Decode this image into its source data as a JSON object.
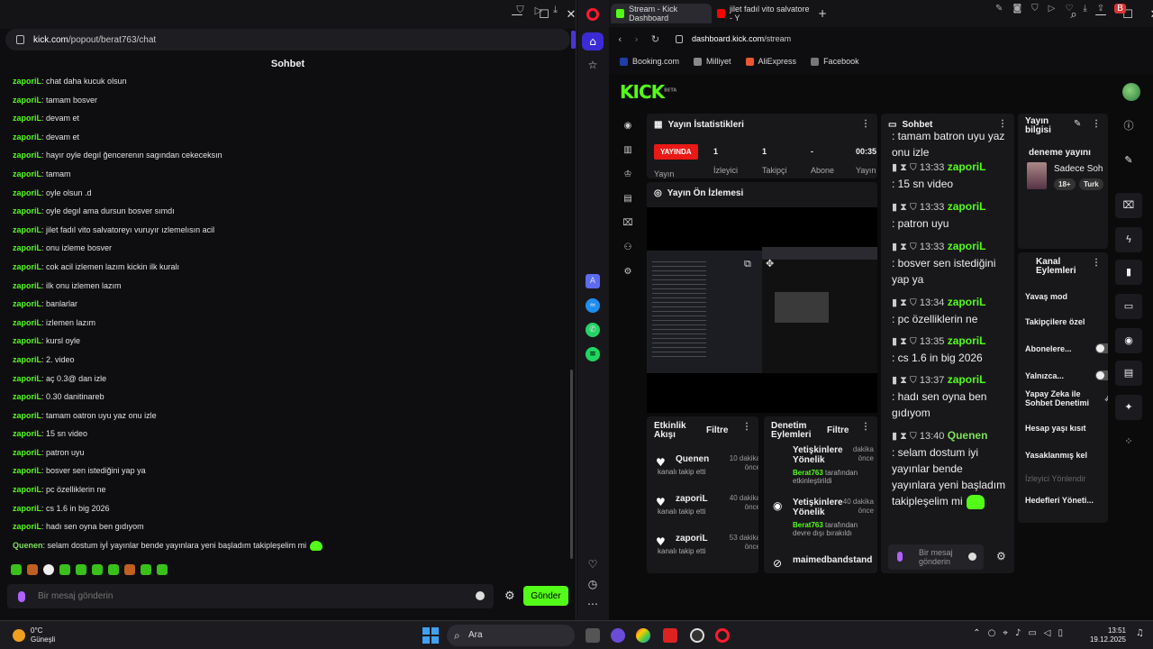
{
  "left_window": {
    "url_domain": "kick.com",
    "url_path": "/popout/berat763/chat",
    "chat_title": "Sohbet",
    "messages": [
      {
        "user": "zaporiL",
        "text": ": chat daha kucuk olsun"
      },
      {
        "user": "zaporiL",
        "text": ": tamam bosver"
      },
      {
        "user": "zaporiL",
        "text": ": devam et"
      },
      {
        "user": "zaporiL",
        "text": ": devam et"
      },
      {
        "user": "zaporiL",
        "text": ": hayır oyle degıl ğencerenın sagından cekeceksın"
      },
      {
        "user": "zaporiL",
        "text": ": tamam"
      },
      {
        "user": "zaporiL",
        "text": ": oyle olsun .d"
      },
      {
        "user": "zaporiL",
        "text": ": oyle degıl ama dursun bosver sımdı"
      },
      {
        "user": "zaporiL",
        "text": ": jilet fadıl vito salvatoreyı vuruyır ızlemelısın acil"
      },
      {
        "user": "zaporiL",
        "text": ": onu izleme bosver"
      },
      {
        "user": "zaporiL",
        "text": ": cok acil izlemen lazım kickin ilk kuralı"
      },
      {
        "user": "zaporiL",
        "text": ": ilk onu izlemen lazım"
      },
      {
        "user": "zaporiL",
        "text": ": banlarlar"
      },
      {
        "user": "zaporiL",
        "text": ": izlemen lazım"
      },
      {
        "user": "zaporiL",
        "text": ": kursl oyle"
      },
      {
        "user": "zaporiL",
        "text": ": 2. video"
      },
      {
        "user": "zaporiL",
        "text": ": aç 0.3@ dan izle"
      },
      {
        "user": "zaporiL",
        "text": ": 0.30 danitinareb"
      },
      {
        "user": "zaporiL",
        "text": ": tamam oatron uyu yaz onu izle"
      },
      {
        "user": "zaporiL",
        "text": ": 15 sn video"
      },
      {
        "user": "zaporiL",
        "text": ": patron uyu"
      },
      {
        "user": "zaporiL",
        "text": ": bosver sen istediğini yap ya"
      },
      {
        "user": "zaporiL",
        "text": ": pc özelliklerin ne"
      },
      {
        "user": "zaporiL",
        "text": ": cs 1.6 in big 2026"
      },
      {
        "user": "zaporiL",
        "text": ": hadı sen oyna ben gıdıyom"
      },
      {
        "user": "Quenen",
        "text": ": selam dostum iyİ yayınlar bende yayınlara yeni başladım takipleşelim mi"
      }
    ],
    "input_placeholder": "Bir mesaj gönderin",
    "send_label": "Gönder"
  },
  "right_window": {
    "tabs": [
      {
        "label": "Stream - Kick Dashboard"
      },
      {
        "label": "jilet fadıl vito salvatore - Y"
      }
    ],
    "url_domain": "dashboard.kick.com",
    "url_path": "/stream",
    "bookmarks": [
      "Booking.com",
      "Milliyet",
      "AliExpress",
      "Facebook"
    ],
    "logo": "KICK",
    "logo_beta": "BETA",
    "stats": {
      "title": "Yayın İstatistikleri",
      "live": "YAYINDA",
      "viewers": "1",
      "followers": "1",
      "subs": "-",
      "time": "00:35",
      "l_stream": "Yayın",
      "l_viewers": "İzleyici",
      "l_followers": "Takipçi",
      "l_subs": "Abone",
      "l_time": "Yayın"
    },
    "preview_title": "Yayın Ön İzlemesi",
    "chat": {
      "title": "Sohbet",
      "top_text": ": tamam batron uyu yaz onu izle",
      "messages": [
        {
          "time": "13:33",
          "user": "zaporiL",
          "text": ": 15 sn video"
        },
        {
          "time": "13:33",
          "user": "zaporiL",
          "text": ": patron uyu"
        },
        {
          "time": "13:33",
          "user": "zaporiL",
          "text": ": bosver sen istediğini yap ya"
        },
        {
          "time": "13:34",
          "user": "zaporiL",
          "text": ": pc özelliklerin ne"
        },
        {
          "time": "13:35",
          "user": "zaporiL",
          "text": ": cs 1.6 in big 2026"
        },
        {
          "time": "13:37",
          "user": "zaporiL",
          "text": ": hadı sen oyna ben gıdıyom"
        },
        {
          "time": "13:40",
          "user": "Quenen",
          "text": ": selam dostum iyi yayınlar bende yayınlara yeni başladım takipleşelim mi"
        }
      ],
      "input_placeholder": "Bir mesaj gönderin"
    },
    "activity": {
      "title": "Etkinlik Akışı",
      "filter": "Filtre",
      "items": [
        {
          "name": "Quenen",
          "sub": "kanalı takip etti",
          "time": "10 dakika önce"
        },
        {
          "name": "zaporiL",
          "sub": "kanalı takip etti",
          "time": "40 dakika önce"
        },
        {
          "name": "zaporiL",
          "sub": "kanalı takip etti",
          "time": "53 dakika önce"
        }
      ]
    },
    "moderation": {
      "title": "Denetim Eylemleri",
      "filter": "Filtre",
      "items": [
        {
          "name": "Yetişkinlere Yönelik",
          "by": "Berat763",
          "sub": "tarafından etkinleştirildi",
          "time": "dakika önce"
        },
        {
          "name": "Yetişkinlere Yönelik",
          "by": "Berat763",
          "sub": "tarafından devre dışı bırakıldı",
          "time": "40 dakika önce"
        },
        {
          "name": "maimedbandstand",
          "by": "",
          "sub": "",
          "time": ""
        }
      ]
    },
    "stream_info": {
      "title": "Yayın bilgisi",
      "stream_name": "deneme yayını",
      "category": "Sadece Soh",
      "age": "18+",
      "lang": "Turk"
    },
    "channel_actions": {
      "title": "Kanal Eylemleri",
      "items": [
        {
          "label": "Yavaş mod"
        },
        {
          "label": "Takipçilere özel"
        },
        {
          "label": "Abonelere..."
        },
        {
          "label": "Yalnızca..."
        },
        {
          "label": "Yapay Zeka ile Sohbet Denetimi"
        },
        {
          "label": "Hesap yaşı kısıt"
        },
        {
          "label": "Yasaklanmış kel"
        },
        {
          "label": "İzleyici Yönlendir"
        },
        {
          "label": "Hedefleri Yöneti..."
        }
      ]
    }
  },
  "taskbar": {
    "temp": "0°C",
    "weather": "Güneşli",
    "search": "Ara",
    "time": "13:51",
    "date": "19.12.2025"
  }
}
